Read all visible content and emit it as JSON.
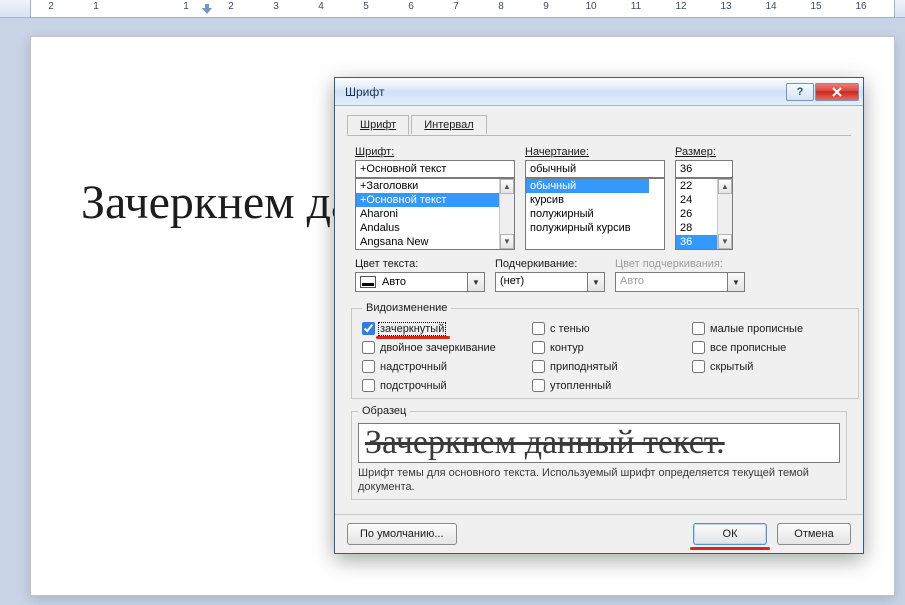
{
  "ruler": {
    "numbers": [
      "2",
      "1",
      "",
      "1",
      "2",
      "3",
      "4",
      "5",
      "6",
      "7",
      "8",
      "9",
      "10",
      "11",
      "12",
      "13",
      "14",
      "15",
      "16"
    ]
  },
  "document": {
    "main_text": "Зачеркнем данный текст."
  },
  "dialog": {
    "title": "Шрифт",
    "tabs": {
      "font": "Шрифт",
      "spacing": "Интервал"
    },
    "labels": {
      "font": "Шрифт:",
      "style": "Начертание:",
      "size": "Размер:",
      "text_color": "Цвет текста:",
      "underline": "Подчеркивание:",
      "underline_color": "Цвет подчеркивания:",
      "effects_group": "Видоизменение",
      "sample_group": "Образец"
    },
    "font": {
      "value": "+Основной текст",
      "options": [
        "+Заголовки",
        "+Основной текст",
        "Aharoni",
        "Andalus",
        "Angsana New"
      ],
      "selected_index": 1
    },
    "style": {
      "value": "обычный",
      "options": [
        "обычный",
        "курсив",
        "полужирный",
        "полужирный курсив"
      ],
      "selected_index": 0
    },
    "size": {
      "value": "36",
      "options": [
        "22",
        "24",
        "26",
        "28",
        "36"
      ],
      "selected_index": 4
    },
    "text_color": {
      "value": "Авто"
    },
    "underline": {
      "value": "(нет)"
    },
    "underline_color": {
      "value": "Авто"
    },
    "effects": {
      "strikethrough": "зачеркнутый",
      "double_strike": "двойное зачеркивание",
      "superscript": "надстрочный",
      "subscript": "подстрочный",
      "shadow": "с тенью",
      "outline": "контур",
      "emboss": "приподнятый",
      "engrave": "утопленный",
      "small_caps": "малые прописные",
      "all_caps": "все прописные",
      "hidden": "скрытый"
    },
    "sample_text": "Зачеркнем данный текст.",
    "sample_note": "Шрифт темы для основного текста. Используемый шрифт определяется текущей темой документа.",
    "footer": {
      "default_btn": "По умолчанию...",
      "ok": "ОК",
      "cancel": "Отмена"
    }
  }
}
